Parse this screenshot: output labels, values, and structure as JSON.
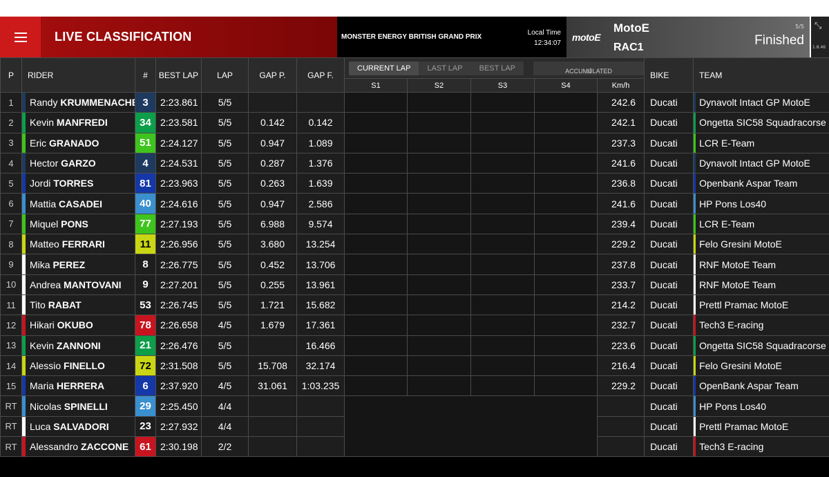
{
  "header": {
    "title": "LIVE CLASSIFICATION",
    "event": "MONSTER ENERGY BRITISH GRAND PRIX",
    "local_time_label": "Local Time",
    "local_time": "12:34:07",
    "logo": "motoE",
    "series": "MotoE",
    "race": "RAC1",
    "laps": "5/5",
    "status": "Finished",
    "version": "1.8.46",
    "menu_icon": "hamburger-icon",
    "collapse_icon": "collapse-arrows-icon"
  },
  "columns": {
    "pos": "P",
    "rider": "RIDER",
    "num": "#",
    "best_lap": "BEST LAP",
    "lap": "LAP",
    "gap_p": "GAP P.",
    "gap_f": "GAP F.",
    "tabs": [
      "CURRENT LAP",
      "LAST LAP",
      "BEST LAP"
    ],
    "accumulated": "ACCUMULATED",
    "s1": "S1",
    "s2": "S2",
    "s3": "S3",
    "s4": "S4",
    "speed": "Km/h",
    "bike": "BIKE",
    "team": "TEAM"
  },
  "rows": [
    {
      "pos": "1",
      "first": "Randy",
      "last": "KRUMMENACHER",
      "num": "3",
      "color": "#1e3a5f",
      "best": "2:23.861",
      "lap": "5/5",
      "gap_p": "",
      "gap_f": "",
      "speed": "242.6",
      "bike": "Ducati",
      "team": "Dynavolt Intact GP MotoE"
    },
    {
      "pos": "2",
      "first": "Kevin",
      "last": "MANFREDI",
      "num": "34",
      "color": "#0d9e4a",
      "best": "2:23.581",
      "lap": "5/5",
      "gap_p": "0.142",
      "gap_f": "0.142",
      "speed": "242.1",
      "bike": "Ducati",
      "team": "Ongetta SIC58 Squadracorse"
    },
    {
      "pos": "3",
      "first": "Eric",
      "last": "GRANADO",
      "num": "51",
      "color": "#3ec41c",
      "best": "2:24.127",
      "lap": "5/5",
      "gap_p": "0.947",
      "gap_f": "1.089",
      "speed": "237.3",
      "bike": "Ducati",
      "team": "LCR E-Team"
    },
    {
      "pos": "4",
      "first": "Hector",
      "last": "GARZO",
      "num": "4",
      "color": "#1e3a5f",
      "best": "2:24.531",
      "lap": "5/5",
      "gap_p": "0.287",
      "gap_f": "1.376",
      "speed": "241.6",
      "bike": "Ducati",
      "team": "Dynavolt Intact GP MotoE"
    },
    {
      "pos": "5",
      "first": "Jordi",
      "last": "TORRES",
      "num": "81",
      "color": "#1538a8",
      "best": "2:23.963",
      "lap": "5/5",
      "gap_p": "0.263",
      "gap_f": "1.639",
      "speed": "236.8",
      "bike": "Ducati",
      "team": "Openbank Aspar Team"
    },
    {
      "pos": "6",
      "first": "Mattia",
      "last": "CASADEI",
      "num": "40",
      "color": "#3a8fcf",
      "best": "2:24.616",
      "lap": "5/5",
      "gap_p": "0.947",
      "gap_f": "2.586",
      "speed": "241.6",
      "bike": "Ducati",
      "team": "HP Pons Los40"
    },
    {
      "pos": "7",
      "first": "Miquel",
      "last": "PONS",
      "num": "77",
      "color": "#3ec41c",
      "best": "2:27.193",
      "lap": "5/5",
      "gap_p": "6.988",
      "gap_f": "9.574",
      "speed": "239.4",
      "bike": "Ducati",
      "team": "LCR E-Team"
    },
    {
      "pos": "8",
      "first": "Matteo",
      "last": "FERRARI",
      "num": "11",
      "color": "#c9d614",
      "best": "2:26.956",
      "lap": "5/5",
      "gap_p": "3.680",
      "gap_f": "13.254",
      "speed": "229.2",
      "bike": "Ducati",
      "team": "Felo Gresini MotoE",
      "dark": true
    },
    {
      "pos": "9",
      "first": "Mika",
      "last": "PEREZ",
      "num": "8",
      "color": "#ffffff",
      "best": "2:26.775",
      "lap": "5/5",
      "gap_p": "0.452",
      "gap_f": "13.706",
      "speed": "237.8",
      "bike": "Ducati",
      "team": "RNF MotoE Team",
      "plain": true
    },
    {
      "pos": "10",
      "first": "Andrea",
      "last": "MANTOVANI",
      "num": "9",
      "color": "#ffffff",
      "best": "2:27.201",
      "lap": "5/5",
      "gap_p": "0.255",
      "gap_f": "13.961",
      "speed": "233.7",
      "bike": "Ducati",
      "team": "RNF MotoE Team",
      "plain": true
    },
    {
      "pos": "11",
      "first": "Tito",
      "last": "RABAT",
      "num": "53",
      "color": "#ffffff",
      "best": "2:26.745",
      "lap": "5/5",
      "gap_p": "1.721",
      "gap_f": "15.682",
      "speed": "214.2",
      "bike": "Ducati",
      "team": "Prettl Pramac MotoE",
      "plain": true
    },
    {
      "pos": "12",
      "first": "Hikari",
      "last": "OKUBO",
      "num": "78",
      "color": "#c8141e",
      "best": "2:26.658",
      "lap": "4/5",
      "gap_p": "1.679",
      "gap_f": "17.361",
      "speed": "232.7",
      "bike": "Ducati",
      "team": "Tech3 E-racing"
    },
    {
      "pos": "13",
      "first": "Kevin",
      "last": "ZANNONI",
      "num": "21",
      "color": "#0d9e4a",
      "best": "2:26.476",
      "lap": "5/5",
      "gap_p": "",
      "gap_f": "16.466",
      "speed": "223.6",
      "bike": "Ducati",
      "team": "Ongetta SIC58 Squadracorse"
    },
    {
      "pos": "14",
      "first": "Alessio",
      "last": "FINELLO",
      "num": "72",
      "color": "#c9d614",
      "best": "2:31.508",
      "lap": "5/5",
      "gap_p": "15.708",
      "gap_f": "32.174",
      "speed": "216.4",
      "bike": "Ducati",
      "team": "Felo Gresini MotoE",
      "dark": true
    },
    {
      "pos": "15",
      "first": "Maria",
      "last": "HERRERA",
      "num": "6",
      "color": "#1538a8",
      "best": "2:37.920",
      "lap": "4/5",
      "gap_p": "31.061",
      "gap_f": "1:03.235",
      "speed": "229.2",
      "bike": "Ducati",
      "team": "OpenBank Aspar Team"
    },
    {
      "pos": "RT",
      "first": "Nicolas",
      "last": "SPINELLI",
      "num": "29",
      "color": "#3a8fcf",
      "best": "2:25.450",
      "lap": "4/4",
      "gap_p": "",
      "gap_f": "",
      "speed": "",
      "bike": "Ducati",
      "team": "HP Pons Los40"
    },
    {
      "pos": "RT",
      "first": "Luca",
      "last": "SALVADORI",
      "num": "23",
      "color": "#ffffff",
      "best": "2:27.932",
      "lap": "4/4",
      "gap_p": "",
      "gap_f": "",
      "speed": "",
      "bike": "Ducati",
      "team": "Prettl Pramac MotoE",
      "plain": true
    },
    {
      "pos": "RT",
      "first": "Alessandro",
      "last": "ZACCONE",
      "num": "61",
      "color": "#c8141e",
      "best": "2:30.198",
      "lap": "2/2",
      "gap_p": "",
      "gap_f": "",
      "speed": "",
      "bike": "Ducati",
      "team": "Tech3 E-racing"
    }
  ]
}
